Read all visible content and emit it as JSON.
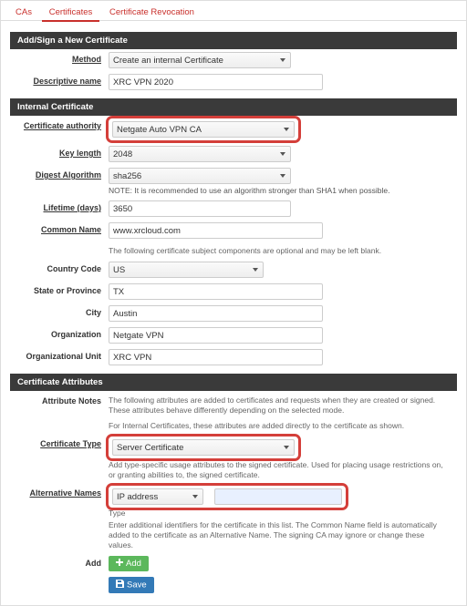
{
  "tabs": {
    "cas": "CAs",
    "certificates": "Certificates",
    "revocation": "Certificate Revocation"
  },
  "section1": {
    "title": "Add/Sign a New Certificate",
    "method_lbl": "Method",
    "method_val": "Create an internal Certificate",
    "desc_lbl": "Descriptive name",
    "desc_val": "XRC VPN 2020"
  },
  "section2": {
    "title": "Internal Certificate",
    "ca_lbl": "Certificate authority",
    "ca_val": "Netgate Auto VPN CA",
    "keylen_lbl": "Key length",
    "keylen_val": "2048",
    "digest_lbl": "Digest Algorithm",
    "digest_val": "sha256",
    "digest_note": "NOTE: It is recommended to use an algorithm stronger than SHA1 when possible.",
    "life_lbl": "Lifetime (days)",
    "life_val": "3650",
    "cn_lbl": "Common Name",
    "cn_val": "www.xrcloud.com",
    "optional_note": "The following certificate subject components are optional and may be left blank.",
    "country_lbl": "Country Code",
    "country_val": "US",
    "state_lbl": "State or Province",
    "state_val": "TX",
    "city_lbl": "City",
    "city_val": "Austin",
    "org_lbl": "Organization",
    "org_val": "Netgate VPN",
    "ou_lbl": "Organizational Unit",
    "ou_val": "XRC VPN"
  },
  "section3": {
    "title": "Certificate Attributes",
    "attrnotes_lbl": "Attribute Notes",
    "attrnotes_txt": "The following attributes are added to certificates and requests when they are created or signed. These attributes behave differently depending on the selected mode.",
    "attrnotes_txt2": "For Internal Certificates, these attributes are added directly to the certificate as shown.",
    "certtype_lbl": "Certificate Type",
    "certtype_val": "Server Certificate",
    "certtype_help": "Add type-specific usage attributes to the signed certificate. Used for placing usage restrictions on, or granting abilities to, the signed certificate.",
    "altnames_lbl": "Alternative Names",
    "altnames_type": "IP address",
    "altnames_val": "",
    "altnames_sublbl": "Type",
    "altnames_help": "Enter additional identifiers for the certificate in this list. The Common Name field is automatically added to the certificate as an Alternative Name. The signing CA may ignore or change these values.",
    "add_lbl": "Add",
    "add_btn": "Add",
    "save_btn": "Save"
  }
}
